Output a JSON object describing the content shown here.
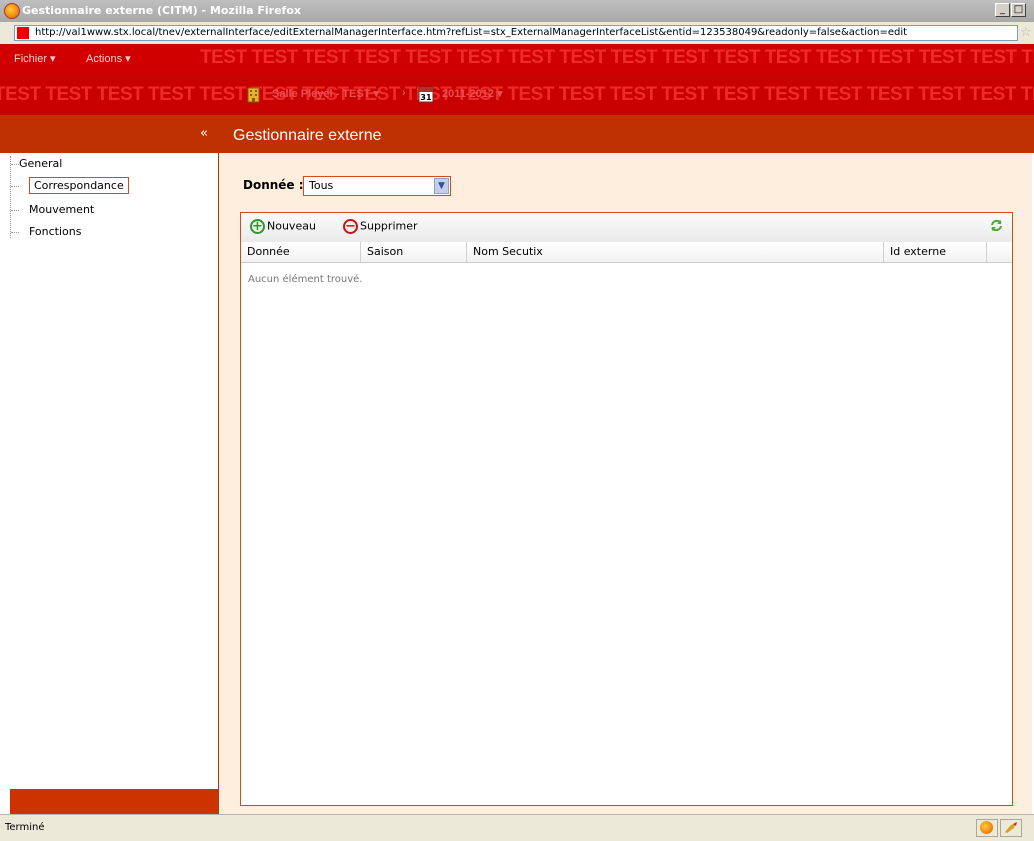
{
  "window": {
    "title": "Gestionnaire externe (CITM) - Mozilla Firefox",
    "minimize": "_",
    "maximize": "□"
  },
  "urlbar": {
    "url": "http://val1www.stx.local/tnev/externalInterface/editExternalManagerInterface.htm?refList=stx_ExternalManagerInterfaceList&entid=123538049&readonly=false&action=edit",
    "bookmark_icon": "star-icon"
  },
  "menubar": {
    "watermark": "TEST TEST TEST TEST TEST TEST TEST TEST TEST TEST TEST TEST TEST TEST TEST TEST TEST TEST TEST TEST",
    "items": [
      {
        "label": "Fichier ▾"
      },
      {
        "label": "Actions ▾"
      }
    ]
  },
  "contextbar": {
    "watermark": "TEST TEST TEST TEST TEST TEST TEST TEST TEST TEST TEST TEST TEST TEST TEST TEST TEST TEST TEST TEST TEST",
    "venue": "Salle Pleyel - TEST ▾",
    "separator": "›",
    "season": "2011-2012 ▾",
    "calendar_day": "31"
  },
  "left_panel": {
    "collapse_label": "«",
    "items": [
      {
        "label": "General"
      },
      {
        "label": "Correspondance",
        "selected": true
      },
      {
        "label": "Mouvement"
      },
      {
        "label": "Fonctions"
      }
    ]
  },
  "main": {
    "title": "Gestionnaire externe",
    "filter": {
      "label": "Donnée :",
      "value": "Tous"
    },
    "toolbar": {
      "new_label": "Nouveau",
      "delete_label": "Supprimer",
      "refresh_icon": "refresh-icon"
    },
    "table": {
      "columns": [
        "Donnée",
        "Saison",
        "Nom Secutix",
        "Id externe"
      ],
      "rows": [],
      "empty_message": "Aucun élément trouvé."
    }
  },
  "statusbar": {
    "text": "Terminé"
  },
  "colors": {
    "brand_red": "#d10000",
    "header_orange": "#c03100",
    "content_bg": "#fdeedd"
  }
}
